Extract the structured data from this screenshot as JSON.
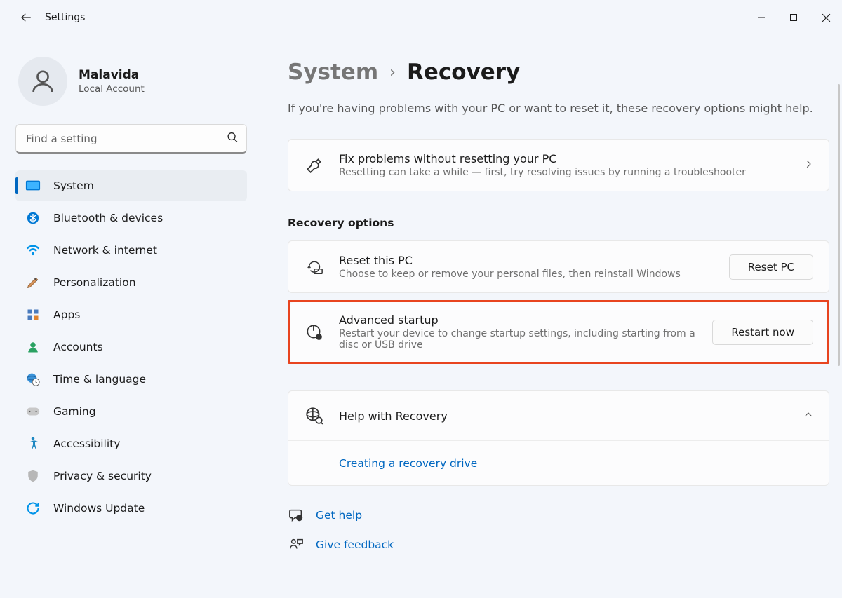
{
  "titlebar": {
    "title": "Settings"
  },
  "profile": {
    "name": "Malavida",
    "subtitle": "Local Account"
  },
  "search": {
    "placeholder": "Find a setting"
  },
  "nav": {
    "items": [
      {
        "key": "system",
        "label": "System",
        "icon": "system",
        "active": true
      },
      {
        "key": "bluetooth",
        "label": "Bluetooth & devices",
        "icon": "bluetooth"
      },
      {
        "key": "network",
        "label": "Network & internet",
        "icon": "wifi"
      },
      {
        "key": "personalization",
        "label": "Personalization",
        "icon": "brush"
      },
      {
        "key": "apps",
        "label": "Apps",
        "icon": "apps"
      },
      {
        "key": "accounts",
        "label": "Accounts",
        "icon": "person"
      },
      {
        "key": "time",
        "label": "Time & language",
        "icon": "globe-clock"
      },
      {
        "key": "gaming",
        "label": "Gaming",
        "icon": "gamepad"
      },
      {
        "key": "accessibility",
        "label": "Accessibility",
        "icon": "accessibility"
      },
      {
        "key": "privacy",
        "label": "Privacy & security",
        "icon": "shield"
      },
      {
        "key": "update",
        "label": "Windows Update",
        "icon": "update"
      }
    ]
  },
  "main": {
    "breadcrumb": {
      "parent": "System",
      "current": "Recovery"
    },
    "subtitle": "If you're having problems with your PC or want to reset it, these recovery options might help.",
    "fixCard": {
      "title": "Fix problems without resetting your PC",
      "subtitle": "Resetting can take a while — first, try resolving issues by running a troubleshooter"
    },
    "sectionHeading": "Recovery options",
    "resetCard": {
      "title": "Reset this PC",
      "subtitle": "Choose to keep or remove your personal files, then reinstall Windows",
      "button": "Reset PC"
    },
    "advancedCard": {
      "title": "Advanced startup",
      "subtitle": "Restart your device to change startup settings, including starting from a disc or USB drive",
      "button": "Restart now"
    },
    "helpCard": {
      "title": "Help with Recovery",
      "link": "Creating a recovery drive"
    },
    "footer": {
      "getHelp": "Get help",
      "feedback": "Give feedback"
    }
  }
}
